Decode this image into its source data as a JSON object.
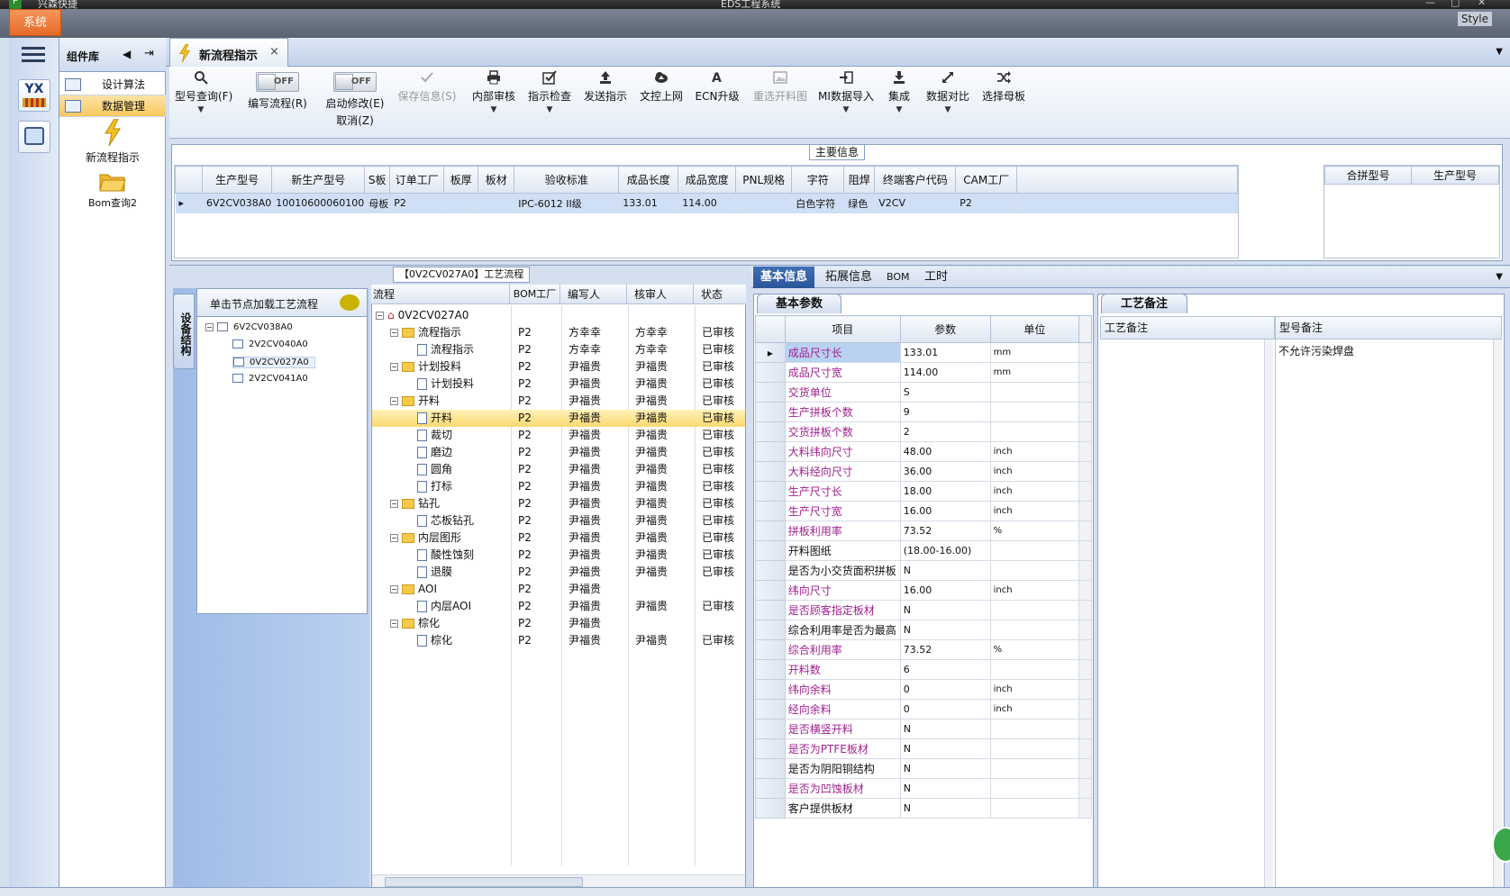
{
  "titlebar": {
    "logo": "P",
    "title": "兴森快捷",
    "center_title": "EDS工程系统",
    "controls": [
      "—",
      "□",
      "✕"
    ]
  },
  "menu": {
    "system_label": "系统",
    "style_label": "Style"
  },
  "component_panel": {
    "title": "组件库",
    "nav": [
      {
        "label": "设计算法",
        "icon": "grid-icon"
      },
      {
        "label": "数据管理",
        "icon": "grid-icon",
        "active": true
      }
    ],
    "tiles": [
      {
        "label": "新流程指示",
        "icon": "lightning-icon"
      },
      {
        "label": "Bom查询2",
        "icon": "folder-open-icon"
      }
    ]
  },
  "document_tab": {
    "label": "新流程指示",
    "close": "×"
  },
  "ribbon": {
    "buttons": [
      {
        "label": "型号查询(F)",
        "icon": "search-icon",
        "dropdown": true
      },
      {
        "label": "编写流程(R)",
        "toggle": "OFF"
      },
      {
        "label": "启动修改(E)",
        "sub": "取消(Z)",
        "toggle": "OFF"
      },
      {
        "label": "保存信息(S)",
        "icon": "check-icon",
        "disabled": true
      },
      {
        "label": "内部审核",
        "icon": "printer-icon",
        "dropdown": true
      },
      {
        "label": "指示检查",
        "icon": "checkbox-icon",
        "dropdown": true
      },
      {
        "label": "发送指示",
        "icon": "upload-icon"
      },
      {
        "label": "文控上网",
        "icon": "cloud-upload-icon"
      },
      {
        "label": "ECN升级",
        "icon": "font-icon"
      },
      {
        "label": "重选开料图",
        "icon": "image-icon",
        "disabled": true
      },
      {
        "label": "MI数据导入",
        "icon": "import-icon",
        "dropdown": true
      },
      {
        "label": "集成",
        "icon": "download-icon",
        "dropdown": true
      },
      {
        "label": "数据对比",
        "icon": "compare-icon",
        "dropdown": true
      },
      {
        "label": "选择母板",
        "icon": "shuffle-icon"
      }
    ]
  },
  "main_info": {
    "title": "主要信息",
    "columns": [
      "生产型号",
      "新生产型号",
      "S板",
      "订单工厂",
      "板厚",
      "板材",
      "验收标准",
      "成品长度",
      "成品宽度",
      "PNL规格",
      "字符",
      "阻焊",
      "终端客户代码",
      "CAM工厂"
    ],
    "rows": [
      [
        "6V2CV038A0",
        "10010600060100",
        "母板",
        "P2",
        "",
        "",
        "IPC-6012 II级",
        "133.01",
        "114.00",
        "",
        "白色字符",
        "绿色",
        "V2CV",
        "P2"
      ]
    ],
    "side_columns": [
      "合拼型号",
      "生产型号"
    ]
  },
  "equipment": {
    "vtab": "设备结构",
    "header": "单击节点加载工艺流程",
    "root": "6V2CV038A0",
    "children": [
      "2V2CV040A0",
      "0V2CV027A0",
      "2V2CV041A0"
    ]
  },
  "flow": {
    "title": "【0V2CV027A0】工艺流程",
    "columns": [
      "流程",
      "BOM工厂",
      "编写人",
      "核审人",
      "状态"
    ],
    "rows": [
      {
        "name": "0V2CV027A0",
        "level": 0,
        "type": "home",
        "factory": "",
        "writer": "",
        "reviewer": "",
        "status": ""
      },
      {
        "name": "流程指示",
        "level": 1,
        "type": "folder",
        "factory": "P2",
        "writer": "方幸幸",
        "reviewer": "方幸幸",
        "status": "已审核"
      },
      {
        "name": "流程指示",
        "level": 2,
        "type": "doc",
        "factory": "P2",
        "writer": "方幸幸",
        "reviewer": "方幸幸",
        "status": "已审核"
      },
      {
        "name": "计划投料",
        "level": 1,
        "type": "folder",
        "factory": "P2",
        "writer": "尹福贵",
        "reviewer": "尹福贵",
        "status": "已审核"
      },
      {
        "name": "计划投料",
        "level": 2,
        "type": "doc",
        "factory": "P2",
        "writer": "尹福贵",
        "reviewer": "尹福贵",
        "status": "已审核"
      },
      {
        "name": "开料",
        "level": 1,
        "type": "folder",
        "factory": "P2",
        "writer": "尹福贵",
        "reviewer": "尹福贵",
        "status": "已审核"
      },
      {
        "name": "开料",
        "level": 2,
        "type": "doc",
        "factory": "P2",
        "writer": "尹福贵",
        "reviewer": "尹福贵",
        "status": "已审核",
        "selected": true
      },
      {
        "name": "裁切",
        "level": 2,
        "type": "doc",
        "factory": "P2",
        "writer": "尹福贵",
        "reviewer": "尹福贵",
        "status": "已审核"
      },
      {
        "name": "磨边",
        "level": 2,
        "type": "doc",
        "factory": "P2",
        "writer": "尹福贵",
        "reviewer": "尹福贵",
        "status": "已审核"
      },
      {
        "name": "圆角",
        "level": 2,
        "type": "doc",
        "factory": "P2",
        "writer": "尹福贵",
        "reviewer": "尹福贵",
        "status": "已审核"
      },
      {
        "name": "打标",
        "level": 2,
        "type": "doc",
        "factory": "P2",
        "writer": "尹福贵",
        "reviewer": "尹福贵",
        "status": "已审核"
      },
      {
        "name": "钻孔",
        "level": 1,
        "type": "folder",
        "factory": "P2",
        "writer": "尹福贵",
        "reviewer": "尹福贵",
        "status": "已审核"
      },
      {
        "name": "芯板钻孔",
        "level": 2,
        "type": "doc",
        "factory": "P2",
        "writer": "尹福贵",
        "reviewer": "尹福贵",
        "status": "已审核"
      },
      {
        "name": "内层图形",
        "level": 1,
        "type": "folder",
        "factory": "P2",
        "writer": "尹福贵",
        "reviewer": "尹福贵",
        "status": "已审核"
      },
      {
        "name": "酸性蚀刻",
        "level": 2,
        "type": "doc",
        "factory": "P2",
        "writer": "尹福贵",
        "reviewer": "尹福贵",
        "status": "已审核"
      },
      {
        "name": "退膜",
        "level": 2,
        "type": "doc",
        "factory": "P2",
        "writer": "尹福贵",
        "reviewer": "尹福贵",
        "status": "已审核"
      },
      {
        "name": "AOI",
        "level": 1,
        "type": "folder",
        "factory": "P2",
        "writer": "尹福贵",
        "reviewer": "",
        "status": ""
      },
      {
        "name": "内层AOI",
        "level": 2,
        "type": "doc",
        "factory": "P2",
        "writer": "尹福贵",
        "reviewer": "尹福贵",
        "status": "已审核"
      },
      {
        "name": "棕化",
        "level": 1,
        "type": "folder",
        "factory": "P2",
        "writer": "尹福贵",
        "reviewer": "",
        "status": ""
      },
      {
        "name": "棕化",
        "level": 2,
        "type": "doc",
        "factory": "P2",
        "writer": "尹福贵",
        "reviewer": "尹福贵",
        "status": "已审核"
      }
    ]
  },
  "right_tabs": [
    "基本信息",
    "拓展信息",
    "BOM",
    "工时"
  ],
  "params": {
    "tab": "基本参数",
    "columns": [
      "项目",
      "参数",
      "单位"
    ],
    "rows": [
      {
        "name": "成品尺寸长",
        "value": "133.01",
        "unit": "mm",
        "highlight": true,
        "current": true
      },
      {
        "name": "成品尺寸宽",
        "value": "114.00",
        "unit": "mm",
        "highlight": true
      },
      {
        "name": "交货单位",
        "value": "S",
        "unit": "",
        "highlight": true
      },
      {
        "name": "生产拼板个数",
        "value": "9",
        "unit": "",
        "highlight": true
      },
      {
        "name": "交货拼板个数",
        "value": "2",
        "unit": "",
        "highlight": true
      },
      {
        "name": "大料纬向尺寸",
        "value": "48.00",
        "unit": "inch",
        "highlight": true
      },
      {
        "name": "大料经向尺寸",
        "value": "36.00",
        "unit": "inch",
        "highlight": true
      },
      {
        "name": "生产尺寸长",
        "value": "18.00",
        "unit": "inch",
        "highlight": true
      },
      {
        "name": "生产尺寸宽",
        "value": "16.00",
        "unit": "inch",
        "highlight": true
      },
      {
        "name": "拼板利用率",
        "value": "73.52",
        "unit": "%",
        "highlight": true
      },
      {
        "name": "开料图纸",
        "value": "(18.00-16.00)",
        "unit": "",
        "highlight": false
      },
      {
        "name": "是否为小交货面积拼板",
        "value": "N",
        "unit": "",
        "highlight": false
      },
      {
        "name": "纬向尺寸",
        "value": "16.00",
        "unit": "inch",
        "highlight": true
      },
      {
        "name": "是否顾客指定板材",
        "value": "N",
        "unit": "",
        "highlight": true
      },
      {
        "name": "综合利用率是否为最高",
        "value": "N",
        "unit": "",
        "highlight": false
      },
      {
        "name": "综合利用率",
        "value": "73.52",
        "unit": "%",
        "highlight": true
      },
      {
        "name": "开料数",
        "value": "6",
        "unit": "",
        "highlight": true
      },
      {
        "name": "纬向余料",
        "value": "0",
        "unit": "inch",
        "highlight": true
      },
      {
        "name": "经向余料",
        "value": "0",
        "unit": "inch",
        "highlight": true
      },
      {
        "name": "是否横竖开料",
        "value": "N",
        "unit": "",
        "highlight": true
      },
      {
        "name": "是否为PTFE板材",
        "value": "N",
        "unit": "",
        "highlight": true
      },
      {
        "name": "是否为阴阳铜结构",
        "value": "N",
        "unit": "",
        "highlight": false
      },
      {
        "name": "是否为凹蚀板材",
        "value": "N",
        "unit": "",
        "highlight": true
      },
      {
        "name": "客户提供板材",
        "value": "N",
        "unit": "",
        "highlight": false
      }
    ]
  },
  "process_notes": {
    "tab": "工艺备注",
    "columns": [
      "工艺备注",
      "型号备注"
    ],
    "model_note": "不允许污染焊盘"
  },
  "colors": {
    "accent": "#2b5599",
    "highlight_text": "#a0218f",
    "selected_row": "#fbd970",
    "system_button": "#e56a28"
  }
}
